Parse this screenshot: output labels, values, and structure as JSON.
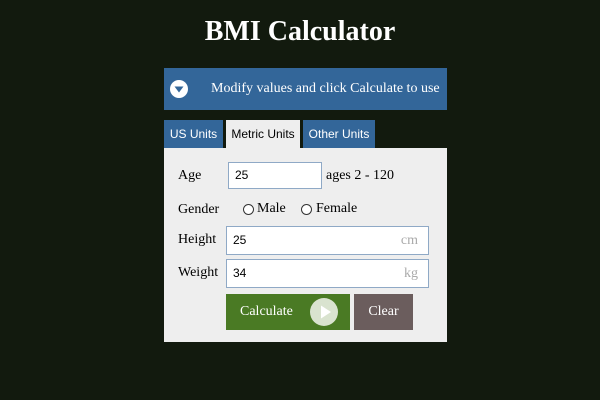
{
  "header": {
    "title": "BMI Calculator"
  },
  "banner": {
    "text": "Modify values and click Calculate to use",
    "icon": "chevron-down-circle-icon"
  },
  "tabs": [
    {
      "label": "US Units",
      "active": false
    },
    {
      "label": "Metric Units",
      "active": true
    },
    {
      "label": "Other Units",
      "active": false
    }
  ],
  "form": {
    "age": {
      "label": "Age",
      "value": "25",
      "hint": "ages 2 - 120"
    },
    "gender": {
      "label": "Gender",
      "options": [
        "Male",
        "Female"
      ],
      "selected": null
    },
    "height": {
      "label": "Height",
      "value": "25",
      "unit": "cm"
    },
    "weight": {
      "label": "Weight",
      "value": "34",
      "unit": "kg"
    }
  },
  "buttons": {
    "calculate": "Calculate",
    "clear": "Clear"
  },
  "colors": {
    "background": "#121a0e",
    "accent": "#336699",
    "panel": "#eeeeee",
    "calculate": "#4a7a24",
    "clear": "#6b5d5d"
  }
}
